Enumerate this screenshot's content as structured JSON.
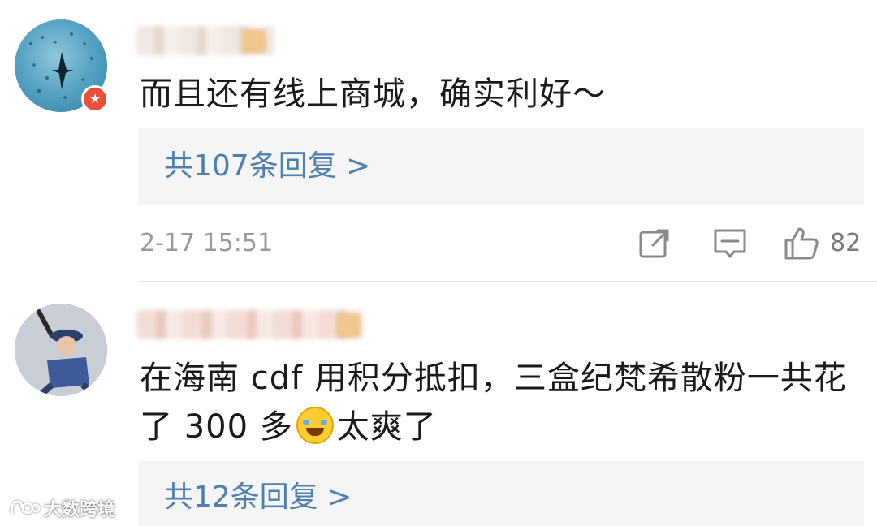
{
  "comments": [
    {
      "text": "而且还有线上商城，确实利好～",
      "replies_label": "共107条回复 >",
      "timestamp": "2-17 15:51",
      "likes": "82",
      "badge_icon": "star-icon"
    },
    {
      "text_before_emoji": "在海南 cdf 用积分抵扣，三盒纪梵希散粉一共花了 300 多",
      "emoji": "laughing-crying-emoji",
      "text_after_emoji": "太爽了",
      "replies_label": "共12条回复 >"
    }
  ],
  "watermark": {
    "text": "大数跨境"
  },
  "colors": {
    "reply_link": "#4f7fb0",
    "reply_bg": "#f5f5f5",
    "meta_gray": "#9a9a9a",
    "badge_red": "#e8503a"
  }
}
